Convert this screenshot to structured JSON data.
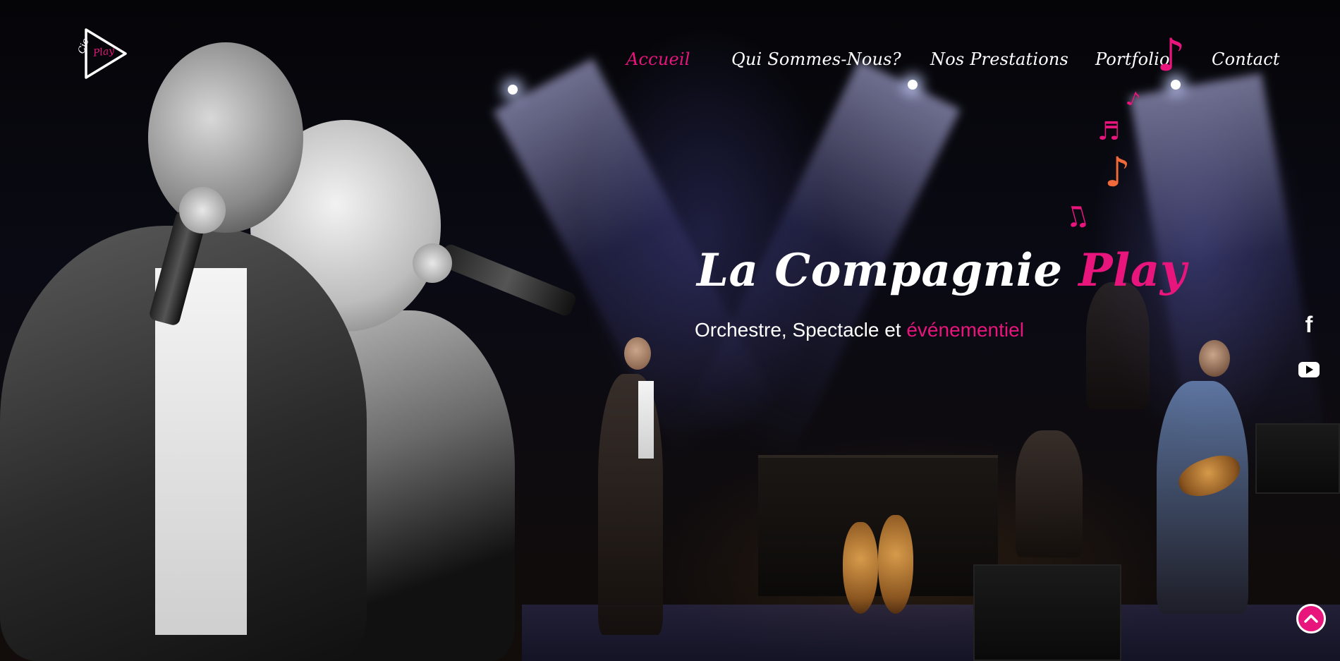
{
  "logo": {
    "cie": "Cie",
    "play": "Play"
  },
  "nav": {
    "items": [
      {
        "label": "Accueil",
        "active": true
      },
      {
        "label": "Qui Sommes-Nous?",
        "active": false
      },
      {
        "label": "Nos Prestations",
        "active": false
      },
      {
        "label": "Portfolio",
        "active": false
      },
      {
        "label": "Contact",
        "active": false
      }
    ]
  },
  "hero": {
    "title_main": "La Compagnie ",
    "title_accent": "Play",
    "subtitle_main": "Orchestre, Spectacle et ",
    "subtitle_accent": "événementiel"
  },
  "social": {
    "facebook_icon": "facebook-icon",
    "youtube_icon": "youtube-icon"
  },
  "back_to_top_icon": "chevron-up-icon",
  "colors": {
    "accent": "#e8157d",
    "text": "#ffffff",
    "background": "#000000"
  }
}
